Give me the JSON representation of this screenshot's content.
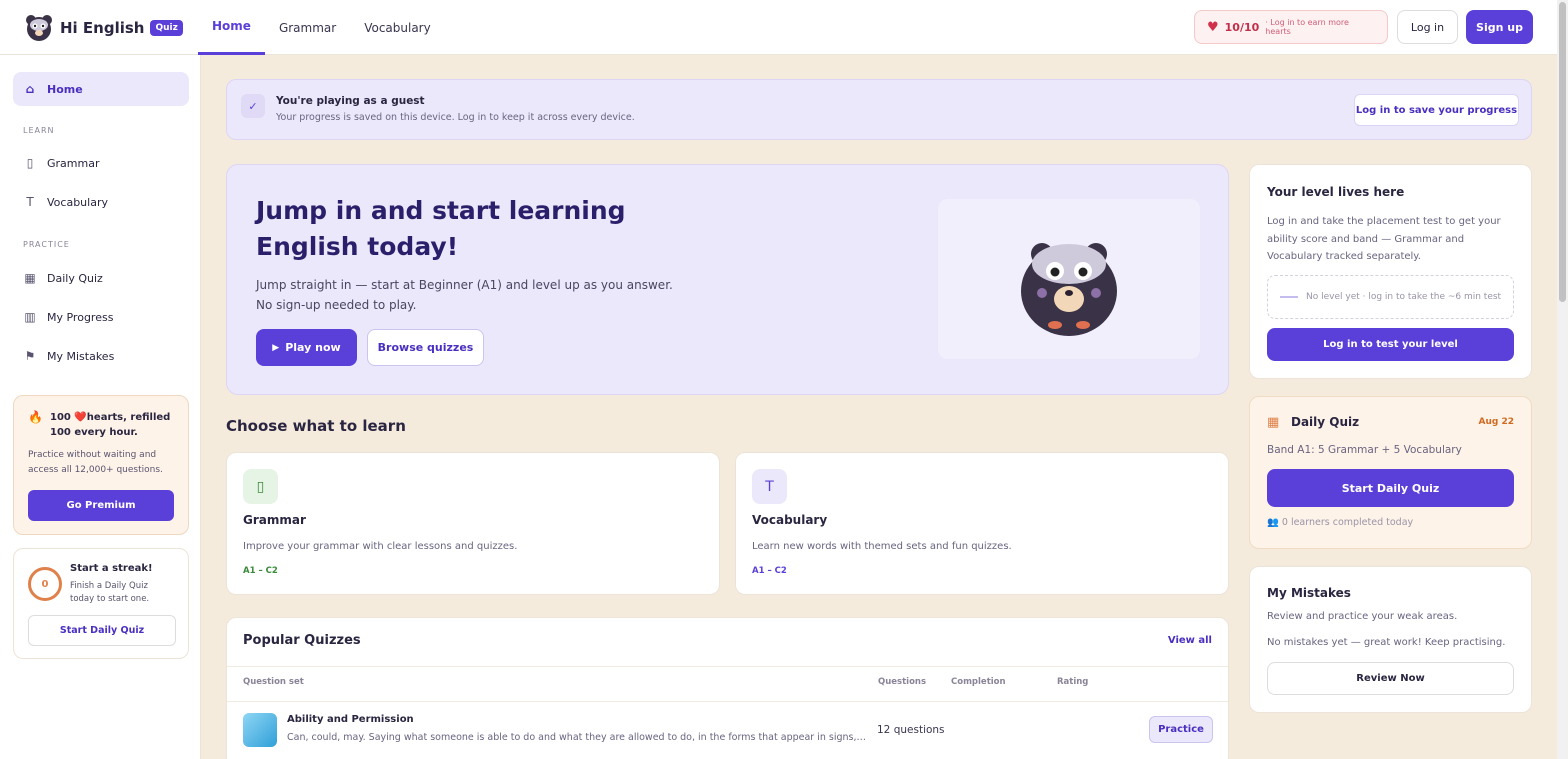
{
  "header": {
    "logo_text": "Hi English",
    "logo_badge": "Quiz",
    "nav": [
      {
        "label": "Home",
        "active": true
      },
      {
        "label": "Grammar",
        "active": false
      },
      {
        "label": "Vocabulary",
        "active": false
      }
    ],
    "hearts_count": "10/10",
    "hearts_hint": "· Log in to earn more hearts",
    "login": "Log in",
    "signup": "Sign up"
  },
  "sidebar": {
    "home": "Home",
    "learn_section": "LEARN",
    "grammar": "Grammar",
    "vocabulary": "Vocabulary",
    "practice_section": "PRACTICE",
    "daily_quiz": "Daily Quiz",
    "my_progress": "My Progress",
    "my_mistakes": "My Mistakes",
    "premium": {
      "title": "100 ❤️hearts, refilled 100 every hour.",
      "desc": "Practice without waiting and access all 12,000+ questions.",
      "button": "Go Premium"
    },
    "streak": {
      "count": "0",
      "title": "Start a streak!",
      "desc": "Finish a Daily Quiz today to start one.",
      "button": "Start Daily Quiz"
    }
  },
  "guest": {
    "title": "You're playing as a guest",
    "desc": "Your progress is saved on this device. Log in to keep it across every device.",
    "button": "Log in to save your progress"
  },
  "hero": {
    "title": "Jump in and start learning English today!",
    "desc": "Jump straight in — start at Beginner (A1) and level up as you answer. No sign-up needed to play.",
    "play": "Play now",
    "browse": "Browse quizzes"
  },
  "choose": {
    "title": "Choose what to learn",
    "cards": [
      {
        "title": "Grammar",
        "desc": "Improve your grammar with clear lessons and quizzes.",
        "levels": "A1 – C2",
        "color": "#3a8a3a"
      },
      {
        "title": "Vocabulary",
        "desc": "Learn new words with themed sets and fun quizzes.",
        "levels": "A1 – C2",
        "color": "#5b3fd9"
      }
    ]
  },
  "popular": {
    "title": "Popular Quizzes",
    "view_all": "View all",
    "columns": [
      "Question set",
      "Questions",
      "Completion",
      "Rating"
    ],
    "rows": [
      {
        "title": "Ability and Permission",
        "desc": "Can, could, may. Saying what someone is able to do and what they are allowed to do, in the forms that appear in signs, rules ...",
        "questions": "12 questions",
        "action": "Practice"
      }
    ]
  },
  "level": {
    "title": "Your level lives here",
    "desc": "Log in and take the placement test to get your ability score and band — Grammar and Vocabulary tracked separately.",
    "placeholder": "No level yet · log in to take the ~6 min test",
    "button": "Log in to test your level"
  },
  "daily": {
    "title": "Daily Quiz",
    "date": "Aug 22",
    "desc": "Band A1: 5 Grammar + 5 Vocabulary",
    "button": "Start Daily Quiz",
    "learners": "0 learners completed today"
  },
  "mistakes": {
    "title": "My Mistakes",
    "desc1": "Review and practice your weak areas.",
    "desc2": "No mistakes yet — great work! Keep practising.",
    "button": "Review Now"
  },
  "colors": {
    "accent": "#5b3fd9",
    "background": "#f4ebdc",
    "heart": "#c0304a"
  }
}
